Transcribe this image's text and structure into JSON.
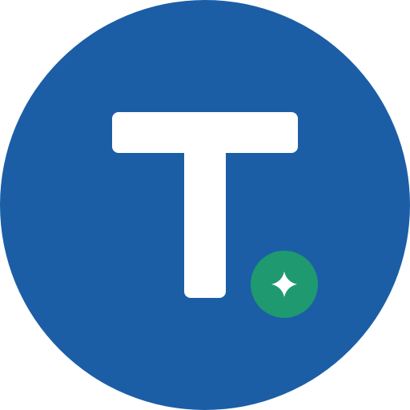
{
  "icon": {
    "letter": "T",
    "colors": {
      "circle_background": "#1b5ea6",
      "letter": "#ffffff",
      "badge_background": "#1f9970",
      "badge_glyph": "#ffffff"
    },
    "badge_icon": "sparkle-icon"
  }
}
